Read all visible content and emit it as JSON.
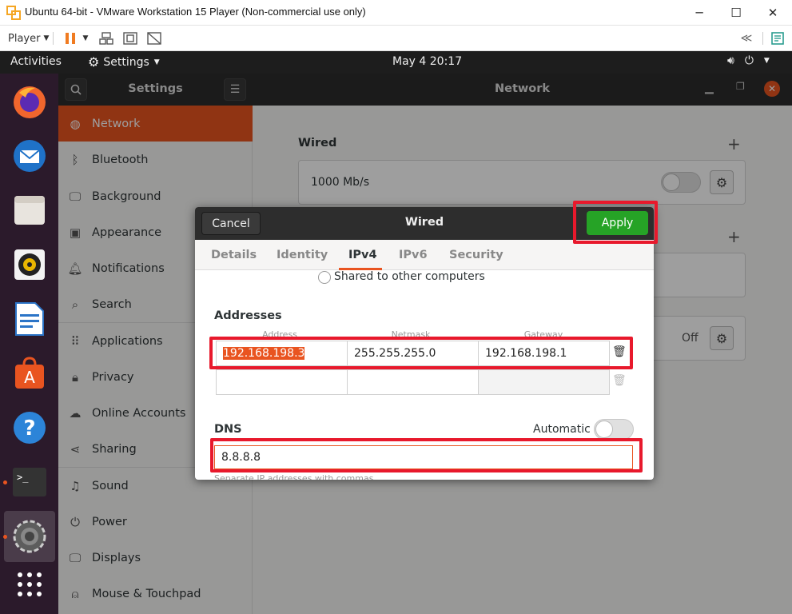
{
  "vmware": {
    "title": "Ubuntu 64-bit - VMware Workstation 15 Player (Non-commercial use only)",
    "player_label": "Player",
    "minimize": "─",
    "maximize": "☐",
    "close": "✕"
  },
  "topbar": {
    "activities": "Activities",
    "app": "Settings",
    "clock": "May 4  20:17"
  },
  "settings": {
    "header_title": "Settings",
    "main_title": "Network"
  },
  "sidebar": {
    "items": [
      {
        "label": "Network",
        "icon": "network-icon"
      },
      {
        "label": "Bluetooth",
        "icon": "bluetooth-icon"
      },
      {
        "label": "Background",
        "icon": "background-icon"
      },
      {
        "label": "Appearance",
        "icon": "appearance-icon"
      },
      {
        "label": "Notifications",
        "icon": "bell-icon"
      },
      {
        "label": "Search",
        "icon": "search-icon"
      },
      {
        "label": "Applications",
        "icon": "grid-icon"
      },
      {
        "label": "Privacy",
        "icon": "lock-icon"
      },
      {
        "label": "Online Accounts",
        "icon": "cloud-icon"
      },
      {
        "label": "Sharing",
        "icon": "share-icon"
      },
      {
        "label": "Sound",
        "icon": "music-icon"
      },
      {
        "label": "Power",
        "icon": "power-icon"
      },
      {
        "label": "Displays",
        "icon": "display-icon"
      },
      {
        "label": "Mouse & Touchpad",
        "icon": "mouse-icon"
      }
    ]
  },
  "network": {
    "wired_label": "Wired",
    "wired_speed": "1000 Mb/s",
    "plus": "+",
    "off": "Off"
  },
  "dialog": {
    "cancel": "Cancel",
    "title": "Wired",
    "apply": "Apply",
    "tabs": [
      "Details",
      "Identity",
      "IPv4",
      "IPv6",
      "Security"
    ],
    "active_tab": "IPv4",
    "shared_option": "Shared to other computers",
    "addresses_heading": "Addresses",
    "col_address": "Address",
    "col_netmask": "Netmask",
    "col_gateway": "Gateway",
    "address": "192.168.198.3",
    "netmask": "255.255.255.0",
    "gateway": "192.168.198.1",
    "dns_heading": "DNS",
    "automatic": "Automatic",
    "dns_value": "8.8.8.8",
    "dns_hint": "Separate IP addresses with commas"
  },
  "colors": {
    "accent": "#e95420",
    "apply_green": "#26a326",
    "highlight_red": "#e8192c"
  }
}
